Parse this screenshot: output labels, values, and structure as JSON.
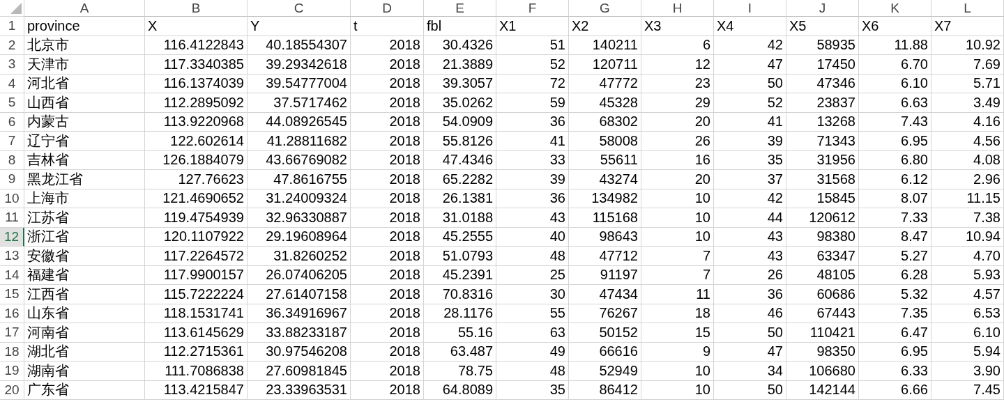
{
  "columns": [
    {
      "label": "A",
      "selected": false
    },
    {
      "label": "B",
      "selected": false
    },
    {
      "label": "C",
      "selected": false
    },
    {
      "label": "D",
      "selected": false
    },
    {
      "label": "E",
      "selected": false
    },
    {
      "label": "F",
      "selected": false
    },
    {
      "label": "G",
      "selected": false
    },
    {
      "label": "H",
      "selected": false
    },
    {
      "label": "I",
      "selected": false
    },
    {
      "label": "J",
      "selected": false
    },
    {
      "label": "K",
      "selected": false
    },
    {
      "label": "L",
      "selected": false
    }
  ],
  "rows": [
    {
      "number": "1",
      "selected": false,
      "cells": [
        "province",
        "X",
        "Y",
        "t",
        "fbl",
        "X1",
        "X2",
        "X3",
        "X4",
        "X5",
        "X6",
        "X7"
      ]
    },
    {
      "number": "2",
      "selected": false,
      "cells": [
        "北京市",
        "116.4122843",
        "40.18554307",
        "2018",
        "30.4326",
        "51",
        "140211",
        "6",
        "42",
        "58935",
        "11.88",
        "10.92"
      ]
    },
    {
      "number": "3",
      "selected": false,
      "cells": [
        "天津市",
        "117.3340385",
        "39.29342618",
        "2018",
        "21.3889",
        "52",
        "120711",
        "12",
        "47",
        "17450",
        "6.70",
        "7.69"
      ]
    },
    {
      "number": "4",
      "selected": false,
      "cells": [
        "河北省",
        "116.1374039",
        "39.54777004",
        "2018",
        "39.3057",
        "72",
        "47772",
        "23",
        "50",
        "47346",
        "6.10",
        "5.71"
      ]
    },
    {
      "number": "5",
      "selected": false,
      "cells": [
        "山西省",
        "112.2895092",
        "37.5717462",
        "2018",
        "35.0262",
        "59",
        "45328",
        "29",
        "52",
        "23837",
        "6.63",
        "3.49"
      ]
    },
    {
      "number": "6",
      "selected": false,
      "cells": [
        "内蒙古",
        "113.9220968",
        "44.08926545",
        "2018",
        "54.0909",
        "36",
        "68302",
        "20",
        "41",
        "13268",
        "7.43",
        "4.16"
      ]
    },
    {
      "number": "7",
      "selected": false,
      "cells": [
        "辽宁省",
        "122.602614",
        "41.28811682",
        "2018",
        "55.8126",
        "41",
        "58008",
        "26",
        "39",
        "71343",
        "6.95",
        "4.56"
      ]
    },
    {
      "number": "8",
      "selected": false,
      "cells": [
        "吉林省",
        "126.1884079",
        "43.66769082",
        "2018",
        "47.4346",
        "33",
        "55611",
        "16",
        "35",
        "31956",
        "6.80",
        "4.08"
      ]
    },
    {
      "number": "9",
      "selected": false,
      "cells": [
        "黑龙江省",
        "127.76623",
        "47.8616755",
        "2018",
        "65.2282",
        "39",
        "43274",
        "20",
        "37",
        "31568",
        "6.12",
        "2.96"
      ]
    },
    {
      "number": "10",
      "selected": false,
      "cells": [
        "上海市",
        "121.4690652",
        "31.24009324",
        "2018",
        "26.1381",
        "36",
        "134982",
        "10",
        "42",
        "15845",
        "8.07",
        "11.15"
      ]
    },
    {
      "number": "11",
      "selected": false,
      "cells": [
        "江苏省",
        "119.4754939",
        "32.96330887",
        "2018",
        "31.0188",
        "43",
        "115168",
        "10",
        "44",
        "120612",
        "7.33",
        "7.38"
      ]
    },
    {
      "number": "12",
      "selected": true,
      "cells": [
        "浙江省",
        "120.1107922",
        "29.19608964",
        "2018",
        "45.2555",
        "40",
        "98643",
        "10",
        "43",
        "98380",
        "8.47",
        "10.94"
      ]
    },
    {
      "number": "13",
      "selected": false,
      "cells": [
        "安徽省",
        "117.2264572",
        "31.8260252",
        "2018",
        "51.0793",
        "48",
        "47712",
        "7",
        "43",
        "63347",
        "5.27",
        "4.70"
      ]
    },
    {
      "number": "14",
      "selected": false,
      "cells": [
        "福建省",
        "117.9900157",
        "26.07406205",
        "2018",
        "45.2391",
        "25",
        "91197",
        "7",
        "26",
        "48105",
        "6.28",
        "5.93"
      ]
    },
    {
      "number": "15",
      "selected": false,
      "cells": [
        "江西省",
        "115.7222224",
        "27.61407158",
        "2018",
        "70.8316",
        "30",
        "47434",
        "11",
        "36",
        "60686",
        "5.32",
        "4.57"
      ]
    },
    {
      "number": "16",
      "selected": false,
      "cells": [
        "山东省",
        "118.1531741",
        "36.34916967",
        "2018",
        "28.1176",
        "55",
        "76267",
        "18",
        "46",
        "67443",
        "7.35",
        "6.53"
      ]
    },
    {
      "number": "17",
      "selected": false,
      "cells": [
        "河南省",
        "113.6145629",
        "33.88233187",
        "2018",
        "55.16",
        "63",
        "50152",
        "15",
        "50",
        "110421",
        "6.47",
        "6.10"
      ]
    },
    {
      "number": "18",
      "selected": false,
      "cells": [
        "湖北省",
        "112.2715361",
        "30.97546208",
        "2018",
        "63.487",
        "49",
        "66616",
        "9",
        "47",
        "98350",
        "6.95",
        "5.94"
      ]
    },
    {
      "number": "19",
      "selected": false,
      "cells": [
        "湖南省",
        "111.7086838",
        "27.60981845",
        "2018",
        "78.75",
        "48",
        "52949",
        "10",
        "34",
        "106680",
        "6.33",
        "3.90"
      ]
    },
    {
      "number": "20",
      "selected": false,
      "cells": [
        "广东省",
        "113.4215847",
        "23.33963531",
        "2018",
        "64.8089",
        "35",
        "86412",
        "10",
        "50",
        "142144",
        "6.66",
        "7.45"
      ]
    }
  ]
}
